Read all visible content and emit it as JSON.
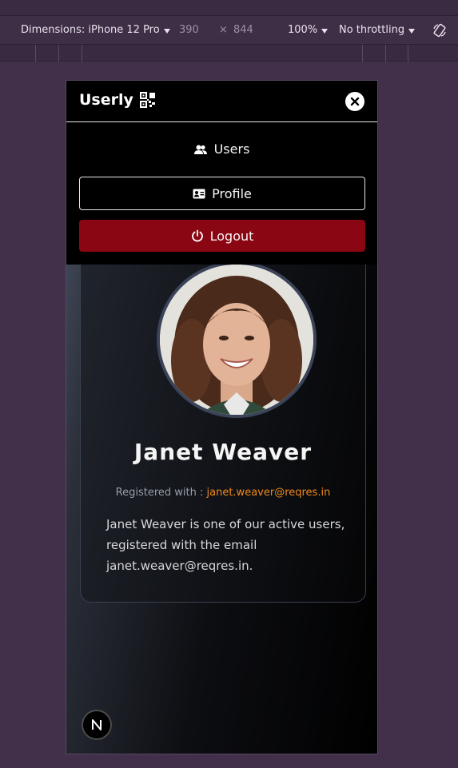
{
  "devtools": {
    "dimensions_label": "Dimensions: iPhone 12 Pro",
    "width": "390",
    "times": "×",
    "height": "844",
    "zoom": "100%",
    "throttling": "No throttling",
    "rotate_icon": "rotate-icon"
  },
  "nav": {
    "brand": "Userly",
    "brand_icon": "qr-code-icon",
    "close_icon": "close-icon",
    "users_label": "Users",
    "users_icon": "users-icon",
    "profile_label": "Profile",
    "profile_icon": "id-card-icon",
    "logout_label": "Logout",
    "logout_icon": "power-icon"
  },
  "profile": {
    "name": "Janet Weaver",
    "registered_prefix": "Registered with : ",
    "email": "janet.weaver@reqres.in",
    "bio": "Janet Weaver is one of our active users, registered with the email janet.weaver@reqres.in."
  },
  "badge": {
    "letter": "N"
  },
  "colors": {
    "logout_bg": "#8b0613",
    "email_accent": "#f28a1a",
    "devtools_bg": "#3e2e46"
  }
}
